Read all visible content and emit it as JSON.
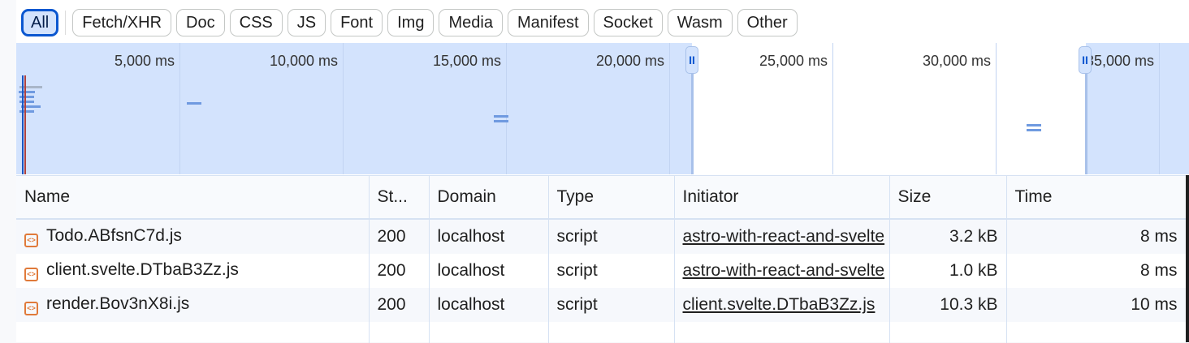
{
  "filters": [
    {
      "label": "All",
      "active": true
    },
    {
      "label": "Fetch/XHR"
    },
    {
      "label": "Doc"
    },
    {
      "label": "CSS"
    },
    {
      "label": "JS"
    },
    {
      "label": "Font"
    },
    {
      "label": "Img"
    },
    {
      "label": "Media"
    },
    {
      "label": "Manifest"
    },
    {
      "label": "Socket"
    },
    {
      "label": "Wasm"
    },
    {
      "label": "Other"
    }
  ],
  "overview": {
    "ticks": [
      "5,000 ms",
      "10,000 ms",
      "15,000 ms",
      "20,000 ms",
      "25,000 ms",
      "30,000 ms",
      "35,000 ms"
    ],
    "selection_ms": [
      23500,
      35500
    ],
    "colors": {
      "background": "#d3e3fd",
      "selection": "#ffffff",
      "bars": "#6f9ae0",
      "dom_content_loaded": "#1a56c4",
      "load": "#b0413e"
    }
  },
  "table": {
    "columns": [
      "Name",
      "St...",
      "Domain",
      "Type",
      "Initiator",
      "Size",
      "Time"
    ],
    "rows": [
      {
        "name": "Todo.ABfsnC7d.js",
        "status": "200",
        "domain": "localhost",
        "type": "script",
        "initiator": "astro-with-react-and-svelte",
        "size": "3.2 kB",
        "time": "8 ms",
        "icon": "script-file-icon"
      },
      {
        "name": "client.svelte.DTbaB3Zz.js",
        "status": "200",
        "domain": "localhost",
        "type": "script",
        "initiator": "astro-with-react-and-svelte",
        "size": "1.0 kB",
        "time": "8 ms",
        "icon": "script-file-icon"
      },
      {
        "name": "render.Bov3nX8i.js",
        "status": "200",
        "domain": "localhost",
        "type": "script",
        "initiator": "client.svelte.DTbaB3Zz.js",
        "size": "10.3 kB",
        "time": "10 ms",
        "icon": "script-file-icon"
      }
    ]
  }
}
